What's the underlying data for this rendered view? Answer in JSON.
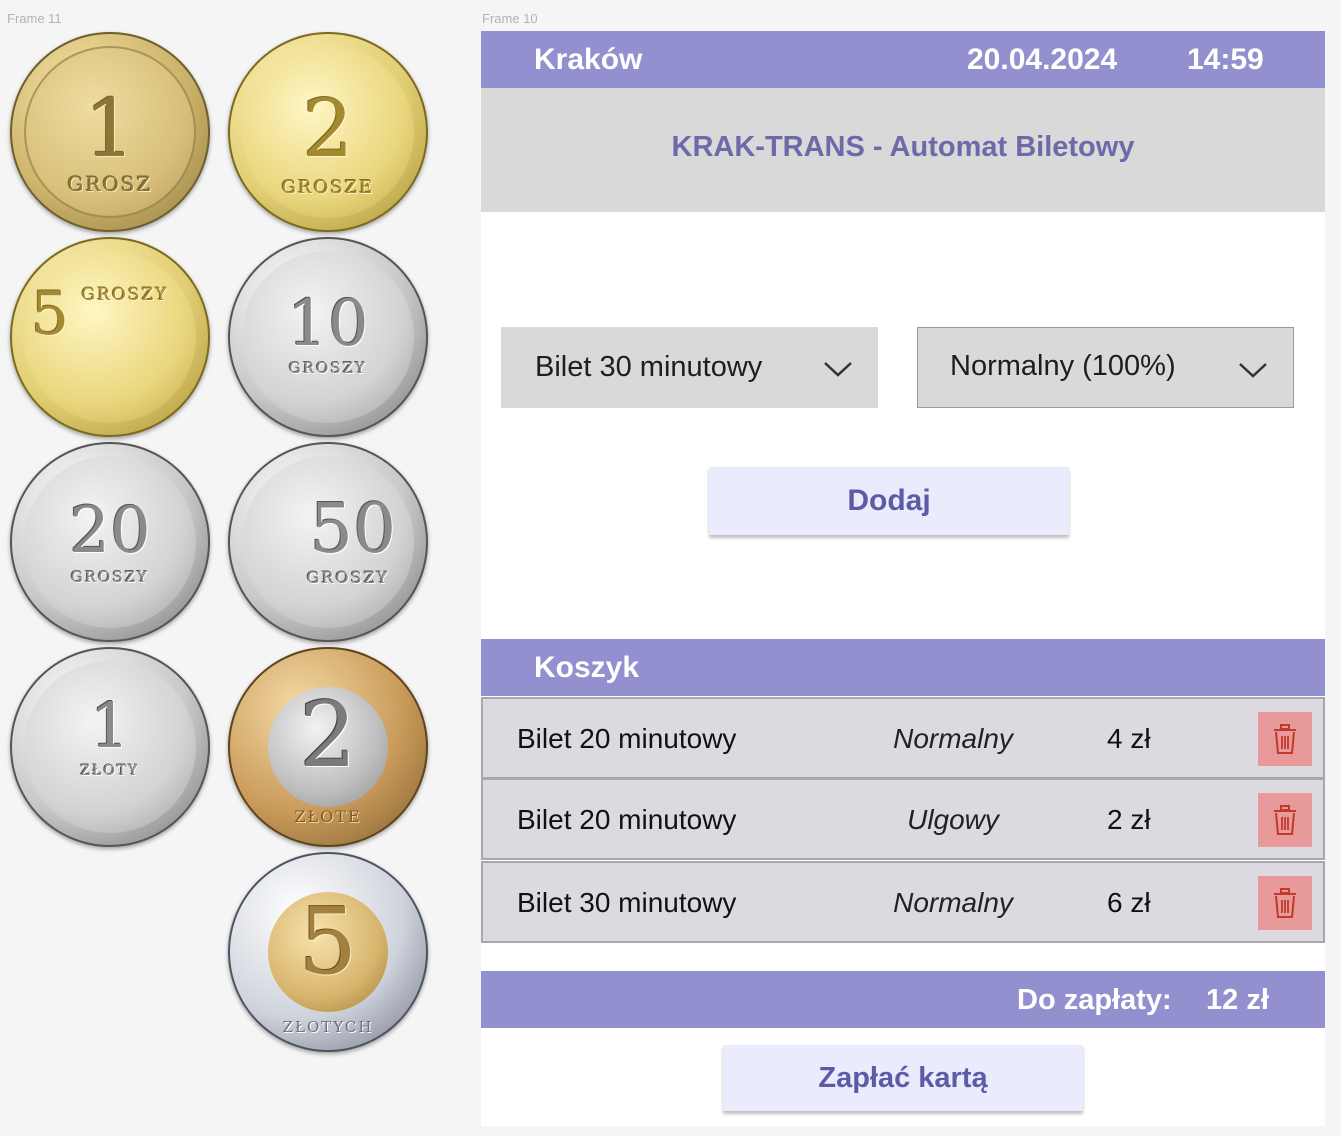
{
  "frames": {
    "left_label": "Frame 11",
    "right_label": "Frame 10"
  },
  "coins": [
    {
      "id": "coin-1-grosz",
      "value": "1",
      "word": "GROSZ",
      "metal": "gold"
    },
    {
      "id": "coin-2-grosze",
      "value": "2",
      "word": "GROSZE",
      "metal": "brass"
    },
    {
      "id": "coin-5-groszy",
      "value": "5",
      "word": "GROSZY",
      "metal": "brass"
    },
    {
      "id": "coin-10-groszy",
      "value": "10",
      "word": "GROSZY",
      "metal": "silver"
    },
    {
      "id": "coin-20-groszy",
      "value": "20",
      "word": "GROSZY",
      "metal": "silver"
    },
    {
      "id": "coin-50-groszy",
      "value": "50",
      "word": "GROSZY",
      "metal": "silver"
    },
    {
      "id": "coin-1-zloty",
      "value": "1",
      "word": "ZŁOTY",
      "metal": "silver"
    },
    {
      "id": "coin-2-zlote",
      "value": "2",
      "word": "ZŁOTE",
      "metal": "bimetal"
    },
    {
      "id": "coin-5-zlotych",
      "value": "5",
      "word": "ZŁOTYCH",
      "metal": "bimetal"
    }
  ],
  "header": {
    "city": "Kraków",
    "date": "20.04.2024",
    "time": "14:59"
  },
  "title": "KRAK-TRANS - Automat Biletowy",
  "selectors": {
    "ticket": "Bilet 30 minutowy",
    "discount": "Normalny (100%)"
  },
  "add_button": "Dodaj",
  "cart": {
    "title": "Koszyk",
    "items": [
      {
        "name": "Bilet 20 minutowy",
        "type": "Normalny",
        "price": "4 zł"
      },
      {
        "name": "Bilet 20 minutowy",
        "type": "Ulgowy",
        "price": "2 zł"
      },
      {
        "name": "Bilet 30 minutowy",
        "type": "Normalny",
        "price": "6 zł"
      }
    ]
  },
  "total": {
    "label": "Do zapłaty:",
    "value": "12 zł"
  },
  "pay_button": "Zapłać kartą",
  "colors": {
    "accent": "#9290cf",
    "title_text": "#6d6aaa",
    "button_bg": "#eaecfd",
    "delete_bg": "#e89a9a"
  }
}
